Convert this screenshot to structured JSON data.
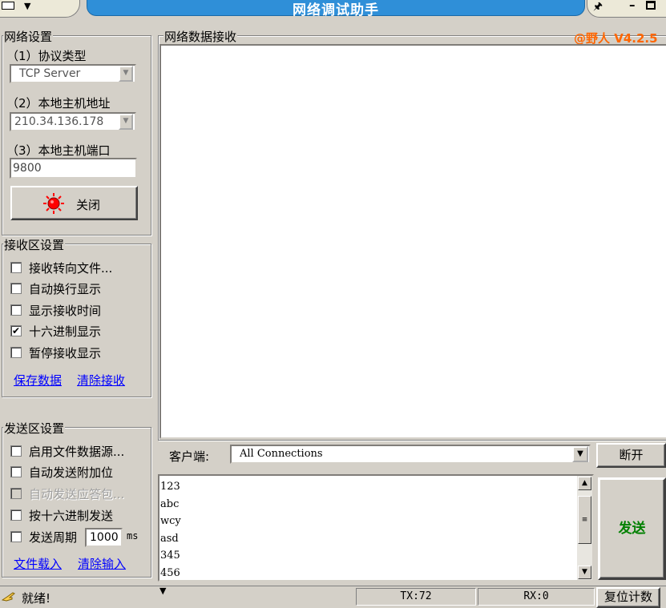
{
  "window": {
    "title": "网络调试助手",
    "menu_arrow": "▼",
    "pin_glyph": "🖈",
    "minimize_glyph": "–"
  },
  "network_settings": {
    "title": "网络设置",
    "protocol_label": "（1）协议类型",
    "protocol_value": "TCP Server",
    "host_label": "（2）本地主机地址",
    "host_value": "210.34.136.178",
    "port_label": "（3）本地主机端口",
    "port_value": "9800",
    "close_button_label": "关闭"
  },
  "receive_settings": {
    "title": "接收区设置",
    "options": [
      {
        "label": "接收转向文件...",
        "checked": false
      },
      {
        "label": "自动换行显示",
        "checked": false
      },
      {
        "label": "显示接收时间",
        "checked": false
      },
      {
        "label": "十六进制显示",
        "checked": true
      },
      {
        "label": "暂停接收显示",
        "checked": false
      }
    ],
    "save_link": "保存数据",
    "clear_link": "清除接收"
  },
  "send_settings": {
    "title": "发送区设置",
    "options": [
      {
        "label": "启用文件数据源...",
        "checked": false,
        "disabled": false
      },
      {
        "label": "自动发送附加位",
        "checked": false,
        "disabled": false
      },
      {
        "label": "自动发送应答包...",
        "checked": false,
        "disabled": true
      },
      {
        "label": "按十六进制发送",
        "checked": false,
        "disabled": false
      },
      {
        "label": "发送周期",
        "checked": false,
        "disabled": false
      }
    ],
    "period_value": "1000",
    "period_unit": "ms",
    "load_link": "文件载入",
    "clear_link": "清除输入"
  },
  "receive_panel": {
    "title": "网络数据接收",
    "version": "@野人 V4.2.5"
  },
  "client": {
    "label": "客户端:",
    "selected": "All Connections",
    "disconnect_button": "断开"
  },
  "send_box": {
    "lines": [
      "123",
      "abc",
      "wcy",
      "asd",
      "345",
      "456"
    ],
    "send_button": "发送"
  },
  "status_bar": {
    "status": "就绪!",
    "arrow": "▼",
    "tx": "TX:72",
    "rx": "RX:0",
    "reset_button": "复位计数"
  },
  "colors": {
    "title_bar": "#2f8fd8",
    "version": "#ff6600",
    "send_button_text": "#008000",
    "link": "#0000ff",
    "led": "#ff0000"
  }
}
